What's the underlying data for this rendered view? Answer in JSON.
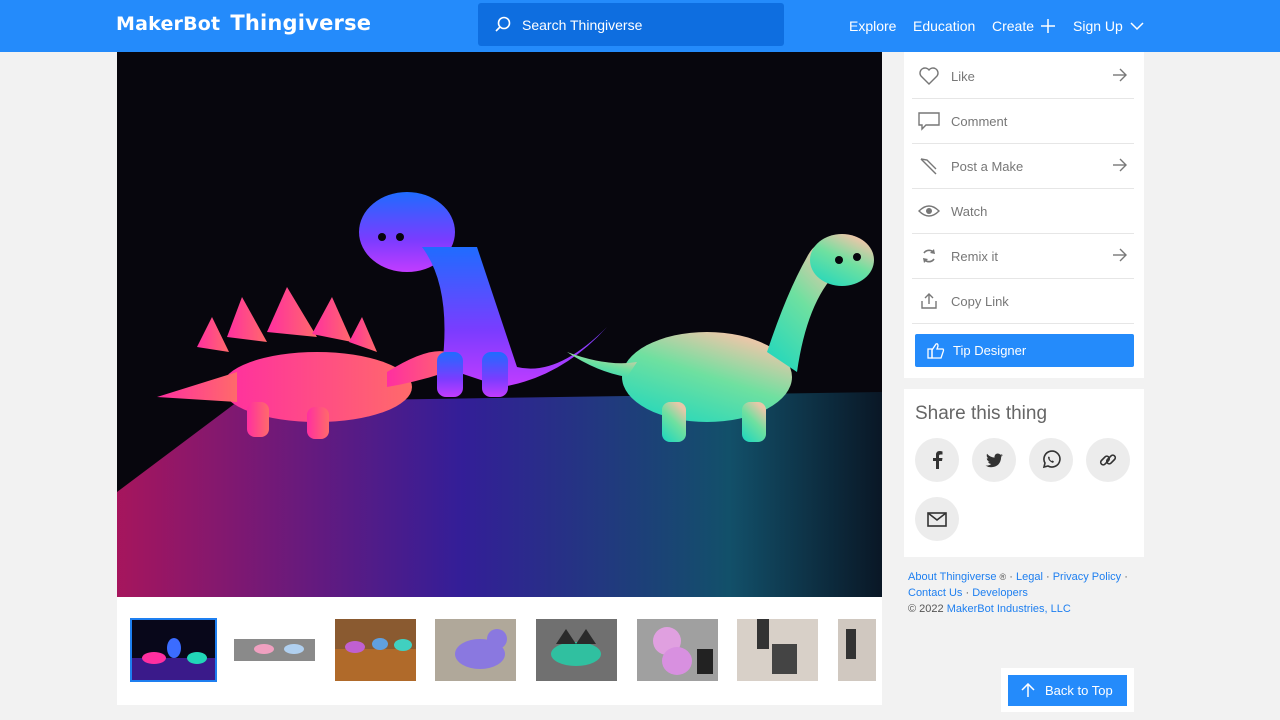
{
  "header": {
    "logo_part1": "MakerBot",
    "logo_part2": "Thingiverse",
    "search_placeholder": "Search Thingiverse",
    "nav": {
      "explore": "Explore",
      "education": "Education",
      "create": "Create",
      "signup": "Sign Up"
    }
  },
  "actions": [
    {
      "label": "Like",
      "icon": "heart-icon",
      "arrow": true
    },
    {
      "label": "Comment",
      "icon": "comment-icon",
      "arrow": false
    },
    {
      "label": "Post a Make",
      "icon": "pen-icon",
      "arrow": true
    },
    {
      "label": "Watch",
      "icon": "eye-icon",
      "arrow": false
    },
    {
      "label": "Remix it",
      "icon": "remix-icon",
      "arrow": true
    },
    {
      "label": "Copy Link",
      "icon": "upload-icon",
      "arrow": false
    }
  ],
  "tip_label": "Tip Designer",
  "share": {
    "title": "Share this thing",
    "buttons": [
      "facebook-icon",
      "twitter-icon",
      "whatsapp-icon",
      "link-icon",
      "email-icon"
    ]
  },
  "footer": {
    "about": "About Thingiverse",
    "registered": "®",
    "legal": "Legal",
    "privacy": "Privacy Policy",
    "contact": "Contact Us",
    "developers": "Developers",
    "copyright": "©  2022",
    "company": "MakerBot Industries, LLC"
  },
  "back_to_top": "Back to Top",
  "colors": {
    "brand_blue": "#248bfb",
    "search_blue": "#0e6ee0",
    "link_blue": "#1e7ff0"
  }
}
